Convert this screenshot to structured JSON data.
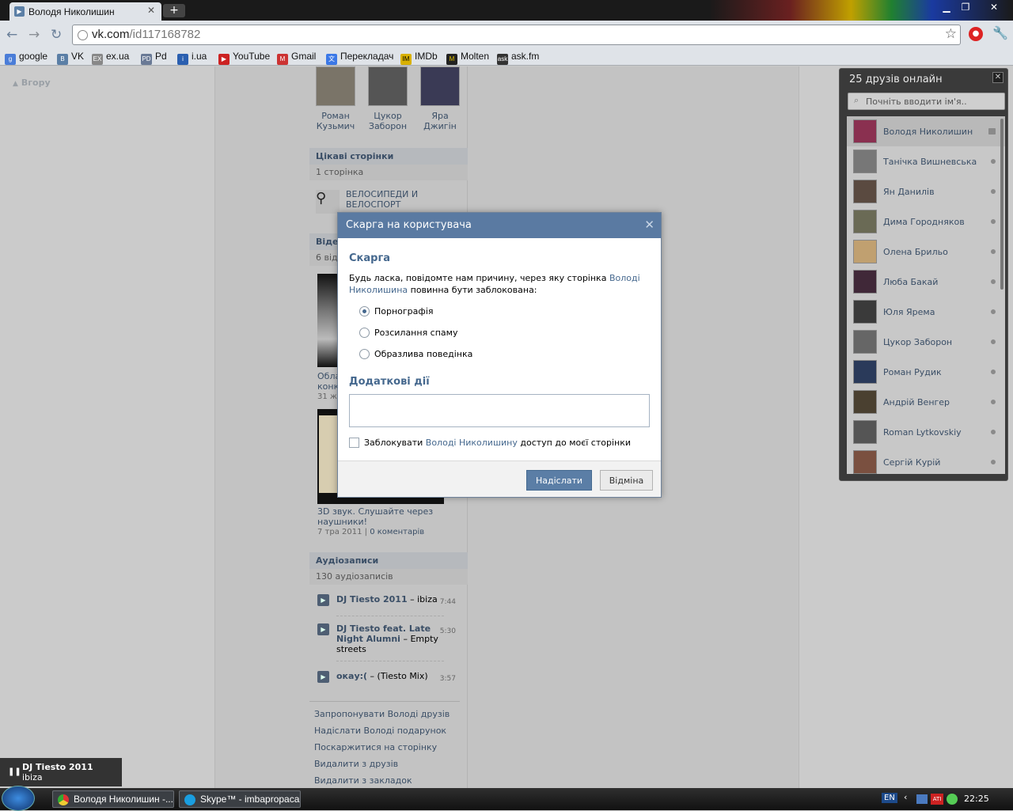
{
  "browser": {
    "tab_title": "Володя Николишин",
    "url_host": "vk.com",
    "url_path": "/id117168782",
    "bookmarks": [
      "google",
      "VK",
      "ex.ua",
      "Pd",
      "i.ua",
      "YouTube",
      "Gmail",
      "Перекладач",
      "IMDb",
      "Molten",
      "ask.fm"
    ]
  },
  "page": {
    "to_top": "Вгору",
    "friends": [
      {
        "name": "Роман Кузьмич"
      },
      {
        "name": "Цукор Заборон"
      },
      {
        "name": "Яра Джигін"
      }
    ],
    "interesting": {
      "title": "Цікаві сторінки",
      "count": "1 сторінка",
      "page_name": "ВЕЛОСИПЕДИ И ВЕЛОСПОРТ"
    },
    "videos": {
      "title_fragment": "Віде",
      "count_fragment": "6 віде",
      "v1_title": "Обла конк",
      "v1_date": "31 жо",
      "v2_title": "3D звук. Слушайте через наушники!",
      "v2_date": "7 тра 2011",
      "v2_comments": "0 коментарів"
    },
    "audio": {
      "title": "Аудіозаписи",
      "count": "130 аудіозаписів",
      "tracks": [
        {
          "artist": "DJ Tiesto 2011",
          "title": "ibiza",
          "duration": "7:44"
        },
        {
          "artist": "DJ Tiesto feat. Late Night Alumni",
          "title": "Empty streets",
          "duration": "5:30"
        },
        {
          "artist": "окау:(",
          "title": "(Tiesto Mix)",
          "duration": "3:57"
        }
      ]
    },
    "actions": [
      "Запропонувати Володі друзів",
      "Надіслати Володі подарунок",
      "Поскаржитися на сторінку",
      "Видалити з друзів",
      "Видалити з закладок"
    ]
  },
  "dialog": {
    "title": "Скарга на користувача",
    "section1": "Скарга",
    "prompt_before": "Будь ласка, повідомте нам причину, через яку сторінка ",
    "prompt_link": "Володі Николишина",
    "prompt_after": " повинна бути заблокована:",
    "reasons": [
      {
        "label": "Порнографія",
        "selected": true
      },
      {
        "label": "Розсилання спаму",
        "selected": false
      },
      {
        "label": "Образлива поведінка",
        "selected": false
      }
    ],
    "section2": "Додаткові дії",
    "comment_value": "",
    "block_before": "Заблокувати ",
    "block_link": "Володі Николишину",
    "block_after": " доступ до моєї сторінки",
    "block_checked": false,
    "submit_label": "Надіслати",
    "cancel_label": "Відміна"
  },
  "online": {
    "title": "25 друзів онлайн",
    "search_placeholder": "Почніть вводити ім'я..",
    "users": [
      "Володя Николишин",
      "Танічка Вишневська",
      "Ян Данилів",
      "Дима Городняков",
      "Олена Брильо",
      "Люба Бакай",
      "Юля Ярема",
      "Цукор Заборон",
      "Роман Рудик",
      "Андрій Венгер",
      "Roman Lytkovskiy",
      "Сергій Курій"
    ]
  },
  "player": {
    "artist": "DJ Tiesto 2011",
    "title": "ibiza"
  },
  "taskbar": {
    "items": [
      "Володя Николишин -...",
      "Skype™ - imbapropacan"
    ],
    "lang": "EN",
    "clock": "22:25"
  }
}
